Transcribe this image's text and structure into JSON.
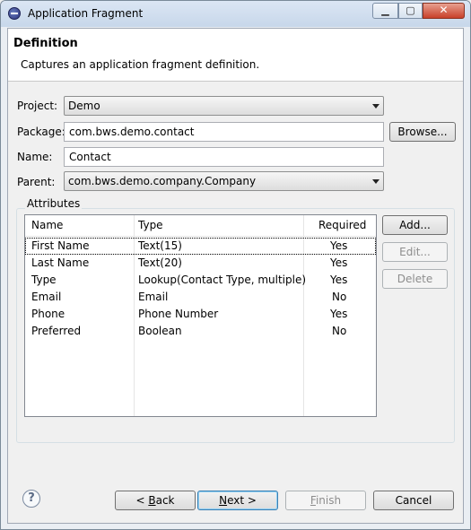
{
  "window": {
    "title": "Application Fragment",
    "close_glyph": "✕"
  },
  "header": {
    "title": "Definition",
    "description": "Captures an application fragment definition."
  },
  "form": {
    "project_label": "Project:",
    "project_value": "Demo",
    "package_label": "Package:",
    "package_value": "com.bws.demo.contact",
    "browse_label": "Browse...",
    "name_label": "Name:",
    "name_value": "Contact",
    "parent_label": "Parent:",
    "parent_value": "com.bws.demo.company.Company"
  },
  "attributes": {
    "group_label": "Attributes",
    "columns": [
      "Name",
      "Type",
      "Required"
    ],
    "rows": [
      [
        "First Name",
        "Text(15)",
        "Yes"
      ],
      [
        "Last Name",
        "Text(20)",
        "Yes"
      ],
      [
        "Type",
        "Lookup(Contact Type, multiple)",
        "Yes"
      ],
      [
        "Email",
        "Email",
        "No"
      ],
      [
        "Phone",
        "Phone Number",
        "Yes"
      ],
      [
        "Preferred",
        "Boolean",
        "No"
      ]
    ],
    "add_label": "Add...",
    "edit_label": "Edit...",
    "delete_label": "Delete"
  },
  "footer": {
    "help_glyph": "?",
    "back_label_prefix": "< ",
    "back_label_mnemonic": "B",
    "back_label_rest": "ack",
    "next_label_mnemonic": "N",
    "next_label_rest": "ext >",
    "finish_label_mnemonic": "F",
    "finish_label_rest": "inish",
    "cancel_label": "Cancel"
  }
}
